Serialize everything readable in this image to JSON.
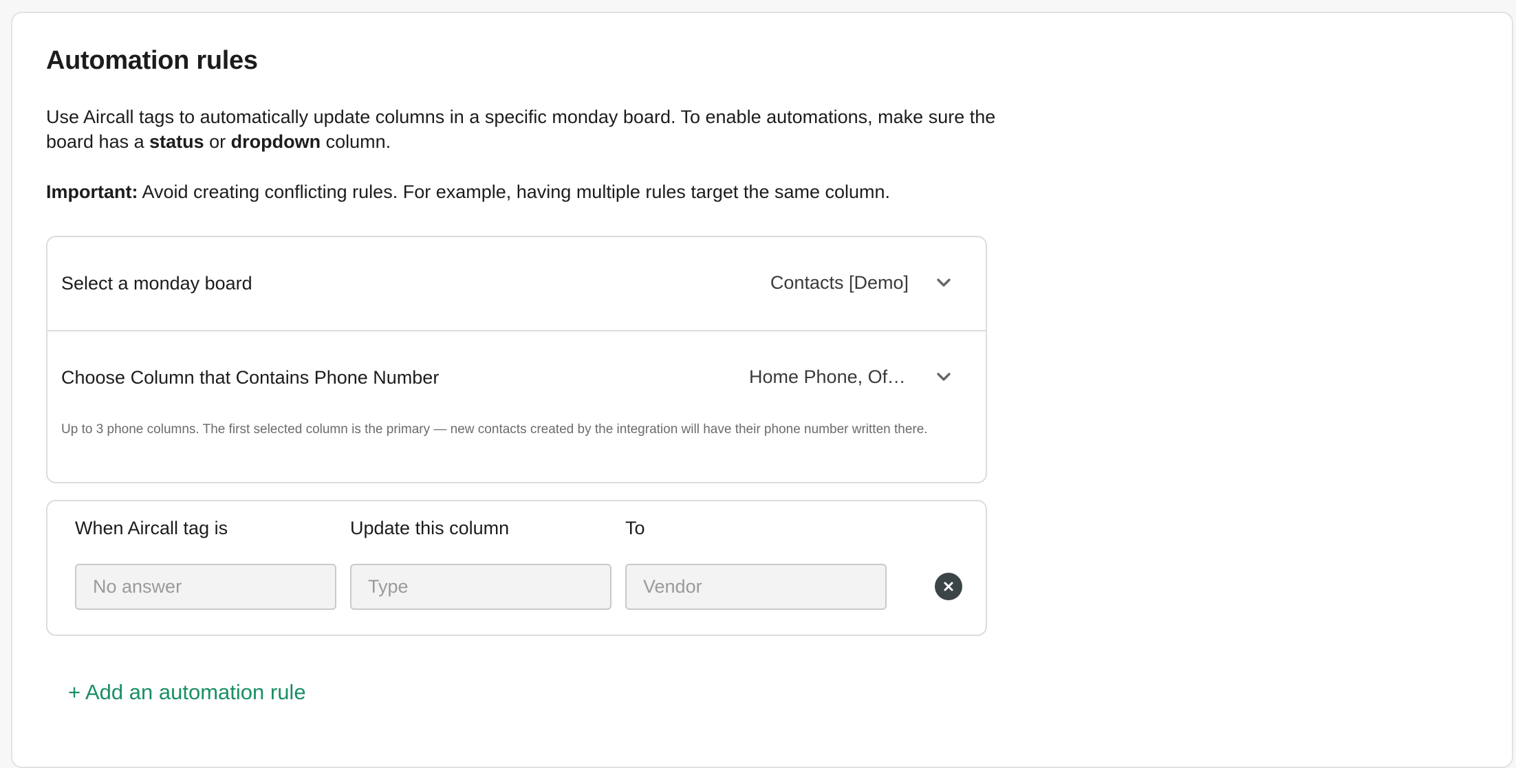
{
  "page": {
    "title": "Automation rules",
    "description": {
      "part1": "Use Aircall tags to automatically update columns in a specific monday board. To enable automations, make sure the board has a ",
      "status_word": "status",
      "part2": " or ",
      "dropdown_word": "dropdown",
      "part3": " column."
    },
    "important": {
      "label": "Important:",
      "text": " Avoid creating conflicting rules. For example, having multiple rules target the same column."
    }
  },
  "settings": {
    "board": {
      "label": "Select a monday board",
      "value": "Contacts [Demo]",
      "icon": "chevron-down-icon"
    },
    "phone_column": {
      "label": "Choose Column that Contains Phone Number",
      "value": "Home Phone, Office Phone",
      "icon": "chevron-down-icon",
      "hint": "Up to 3 phone columns. The first selected column is the primary — new contacts created by the integration will have their phone number written there."
    }
  },
  "rule": {
    "headers": {
      "tag": "When Aircall tag is",
      "column": "Update this column",
      "to": "To"
    },
    "inputs": {
      "tag_placeholder": "No answer",
      "column_placeholder": "Type",
      "to_placeholder": "Vendor"
    },
    "remove_icon": "close-circle-icon"
  },
  "actions": {
    "add_rule_label": "+ Add an automation rule"
  },
  "colors": {
    "accent": "#1a8f64",
    "border": "#dcdcdc",
    "remove_button": "#3b4446"
  }
}
